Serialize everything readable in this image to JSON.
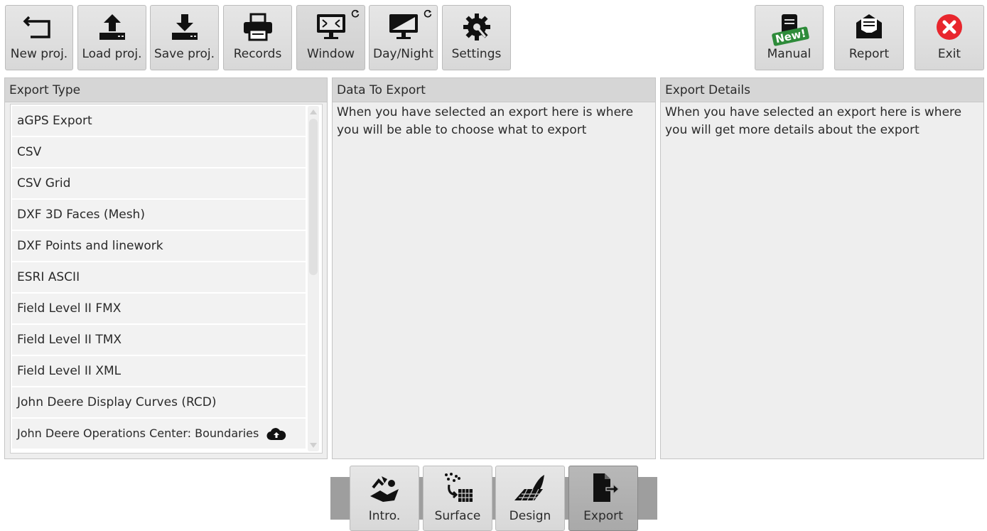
{
  "toolbar": {
    "new_project": "New proj.",
    "load_project": "Load proj.",
    "save_project": "Save proj.",
    "records": "Records",
    "window": "Window",
    "day_night": "Day/Night",
    "settings": "Settings",
    "manual": "Manual",
    "manual_badge": "New!",
    "report": "Report",
    "exit": "Exit"
  },
  "panels": {
    "export_type": {
      "title": "Export Type",
      "items": [
        "aGPS Export",
        "CSV",
        "CSV Grid",
        "DXF 3D Faces (Mesh)",
        "DXF Points and linework",
        "ESRI ASCII",
        "Field Level II FMX",
        "Field Level II TMX",
        "Field Level II XML",
        "John Deere Display Curves (RCD)",
        "John Deere Operations Center: Boundaries"
      ]
    },
    "data_to_export": {
      "title": "Data To Export",
      "text": "When you have selected an export here is where you will be able to choose what to export"
    },
    "export_details": {
      "title": "Export Details",
      "text": "When you have selected an export here is where you will get more details about the export"
    }
  },
  "bottom_tabs": {
    "intro": "Intro.",
    "surface": "Surface",
    "design": "Design",
    "export": "Export",
    "active": "Export"
  },
  "colors": {
    "exit_red": "#e8262d",
    "badge_green": "#2e8b3a",
    "icon_black": "#111111"
  }
}
